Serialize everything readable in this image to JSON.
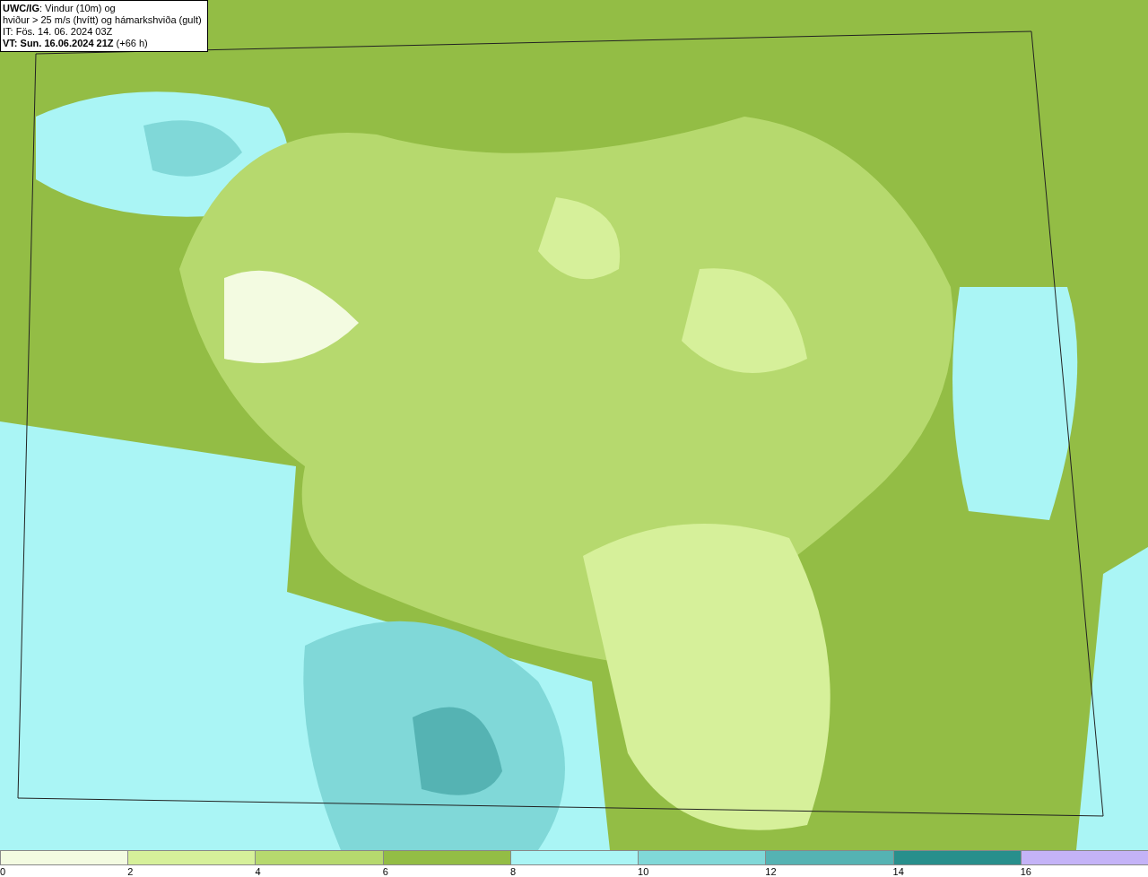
{
  "title_box": {
    "lines": [
      "**UWC/IG**: Vindur (10m) og",
      "hviður > 25 m/s (hvítt) og hámarkshviða (gult)",
      "IT: Fös. 14. 06. 2024 03Z",
      "**VT: Sun. 16.06.2024 21Z** (+66 h)"
    ]
  },
  "legend": [
    {
      "label": "0",
      "color": "#f3fbe1"
    },
    {
      "label": "2",
      "color": "#d6f09a"
    },
    {
      "label": "4",
      "color": "#b6d96e"
    },
    {
      "label": "6",
      "color": "#93bd45"
    },
    {
      "label": "8",
      "color": "#aaf5f5"
    },
    {
      "label": "10",
      "color": "#80d8d8"
    },
    {
      "label": "12",
      "color": "#55b3b3"
    },
    {
      "label": "14",
      "color": "#288f8c"
    },
    {
      "label": "16",
      "color": "#c4b3f7"
    }
  ]
}
